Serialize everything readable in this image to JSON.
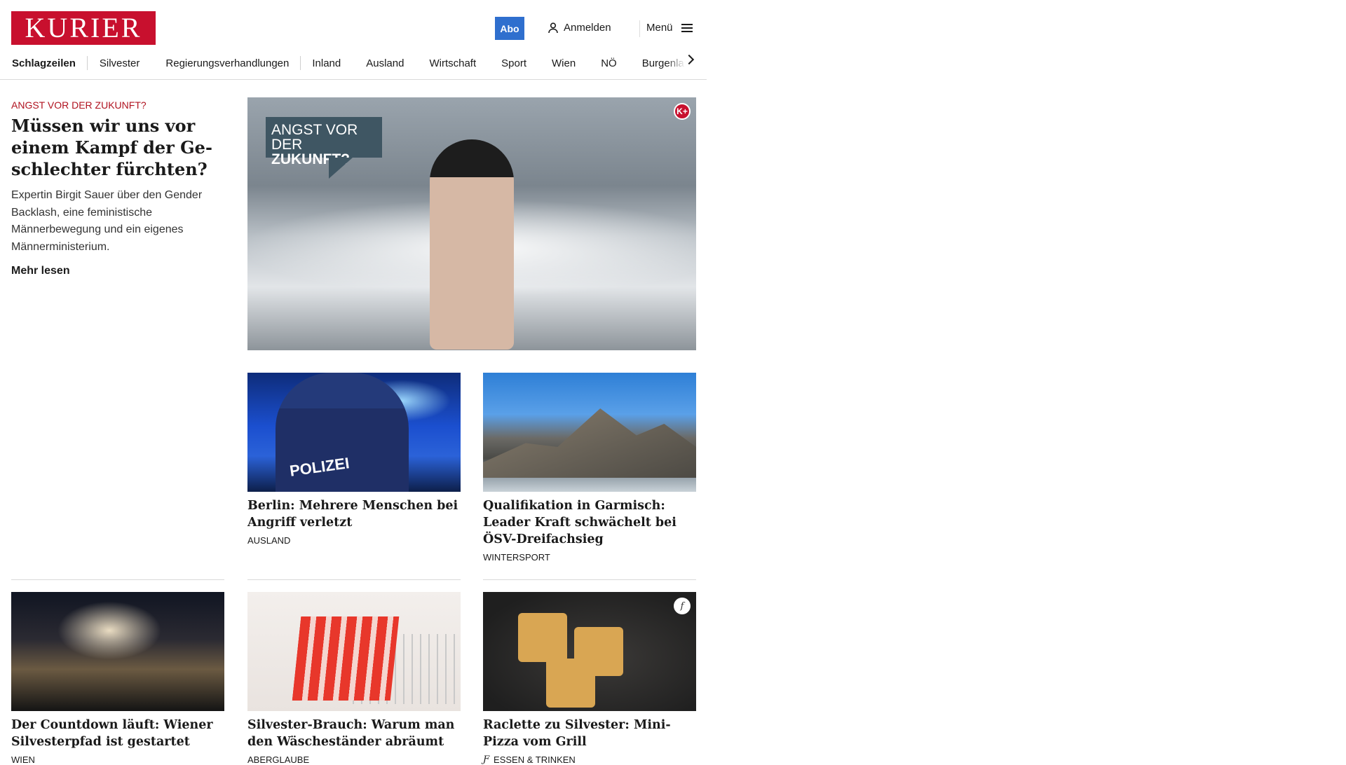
{
  "header": {
    "logo": "KURIER",
    "abo_label": "Abo",
    "login_label": "Anmelden",
    "menu_label": "Menü"
  },
  "nav": {
    "items": [
      "Schlagzeilen",
      "Silvester",
      "Regierungsverhandlungen",
      "Inland",
      "Ausland",
      "Wirtschaft",
      "Sport",
      "Wien",
      "NÖ",
      "Burgenland"
    ]
  },
  "hero": {
    "kicker": "ANGST VOR DER ZUKUNFT?",
    "title": "Müssen wir uns vor ei­nem Kampf der Ge­schlechter fürchten?",
    "teaser": "Expertin Birgit Sauer über den Gender Backlash, eine feministische Männerbewegung und ein eigenes Männerministerium.",
    "more_label": "Mehr lesen",
    "badge_line1": "ANGST VOR DER",
    "badge_line2": "ZUKUNFT?",
    "premium_badge": "K+"
  },
  "cards": [
    {
      "title": "Berlin: Mehrere Menschen bei An­griff verletzt",
      "category": "AUSLAND",
      "image_text": "POLIZEI"
    },
    {
      "title": "Qualifikation in Garmisch: Leader Kraft schwächelt bei ÖSV-Dreifachsieg",
      "category": "WINTERSPORT"
    },
    {
      "title": "Der Countdown läuft: Wiener Sil­vesterpfad ist gestartet",
      "category": "WIEN"
    },
    {
      "title": "Silvester-Brauch: Warum man den Wäscheständer abräumt",
      "category": "ABERGLAUBE"
    },
    {
      "title": "Raclette zu Silvester: Mini-Pizza vom Grill",
      "category": "ESSEN & TRINKEN",
      "badge": "f"
    }
  ],
  "colors": {
    "brand": "#c8102e",
    "abo": "#2f6fce",
    "kicker": "#b0121f"
  },
  "icons": [
    "user-icon",
    "hamburger-icon",
    "chevron-right-icon",
    "premium-k-plus-icon",
    "freizeit-f-icon"
  ]
}
